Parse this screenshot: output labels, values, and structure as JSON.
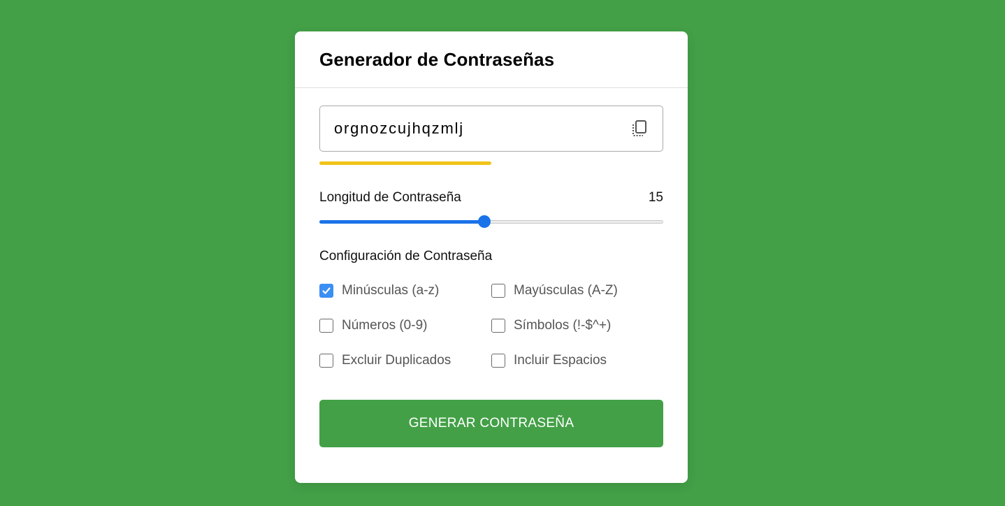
{
  "colors": {
    "background": "#43a047",
    "strength": "#f0c419",
    "slider_accent": "#1a73e8",
    "button": "#43a047",
    "checkbox_checked": "#3b8ef3"
  },
  "header": {
    "title": "Generador de Contraseñas"
  },
  "password": {
    "value": "orgnozcujhqzmlj",
    "copy_icon": "copy-icon",
    "strength_fraction": 0.5
  },
  "length": {
    "label": "Longitud de Contraseña",
    "value": "15",
    "slider_fraction": 0.48
  },
  "settings": {
    "title": "Configuración de Contraseña",
    "options": [
      {
        "label": "Minúsculas (a-z)",
        "checked": true
      },
      {
        "label": "Mayúsculas (A-Z)",
        "checked": false
      },
      {
        "label": "Números (0-9)",
        "checked": false
      },
      {
        "label": "Símbolos (!-$^+)",
        "checked": false
      },
      {
        "label": "Excluir Duplicados",
        "checked": false
      },
      {
        "label": "Incluir Espacios",
        "checked": false
      }
    ]
  },
  "generate_button": {
    "label": "GENERAR CONTRASEÑA"
  }
}
